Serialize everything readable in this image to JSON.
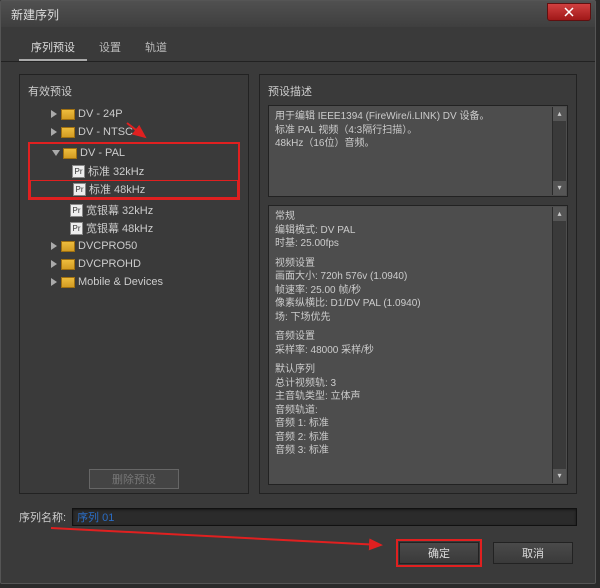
{
  "window": {
    "title": "新建序列"
  },
  "tabs": {
    "preset": "序列预设",
    "settings": "设置",
    "tracks": "轨道"
  },
  "left": {
    "title": "有效预设",
    "items": {
      "dv24p": "DV - 24P",
      "dvntsc": "DV - NTSC",
      "dvpal": "DV - PAL",
      "std32": "标准 32kHz",
      "std48": "标准 48kHz",
      "wide32": "宽银幕 32kHz",
      "wide48": "宽银幕 48kHz",
      "dvcpro50": "DVCPRO50",
      "dvcprohd": "DVCPROHD",
      "mobile": "Mobile & Devices"
    },
    "delete": "删除预设"
  },
  "right": {
    "title": "预设描述",
    "desc": {
      "l1": "用于编辑 IEEE1394 (FireWire/i.LINK) DV 设备。",
      "l2": "标准 PAL 视频（4:3隔行扫描）。",
      "l3": "48kHz（16位）音频。"
    },
    "details": {
      "general_h": "常规",
      "general_l1": "编辑模式: DV PAL",
      "general_l2": "时基: 25.00fps",
      "video_h": "视频设置",
      "video_l1": "画面大小: 720h 576v (1.0940)",
      "video_l2": "帧速率: 25.00 帧/秒",
      "video_l3": "像素纵横比: D1/DV PAL (1.0940)",
      "video_l4": "场: 下场优先",
      "audio_h": "音频设置",
      "audio_l1": "采样率: 48000 采样/秒",
      "def_h": "默认序列",
      "def_l1": "总计视频轨: 3",
      "def_l2": "主音轨类型: 立体声",
      "def_l3": "音频轨道:",
      "def_l4": "音频 1: 标准",
      "def_l5": "音频 2: 标准",
      "def_l6": "音频 3: 标准"
    }
  },
  "sequence": {
    "label": "序列名称:",
    "value": "序列 01"
  },
  "buttons": {
    "ok": "确定",
    "cancel": "取消"
  }
}
